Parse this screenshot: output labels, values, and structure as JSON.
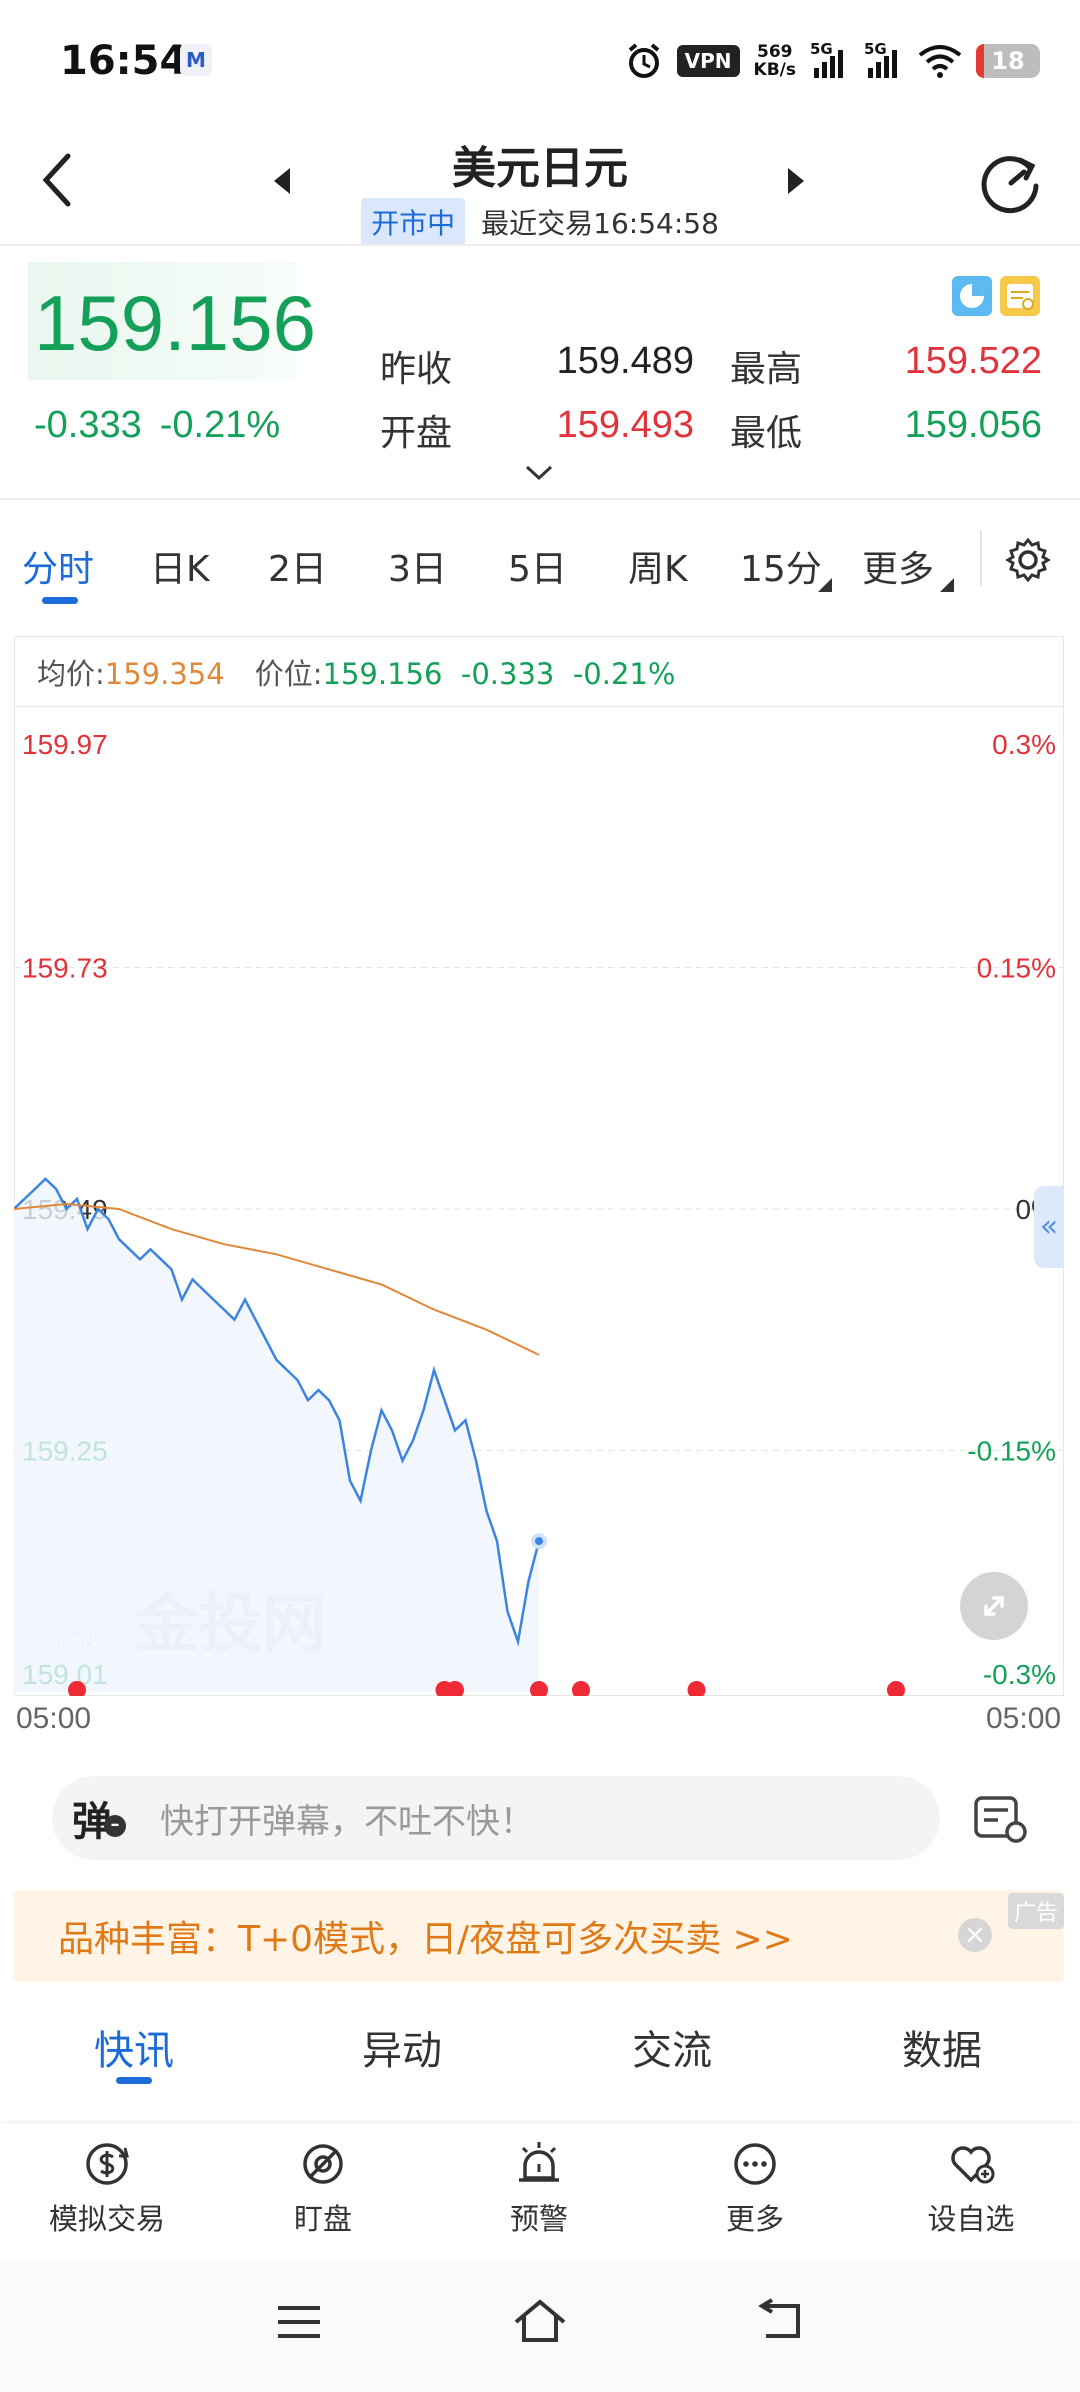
{
  "status_bar": {
    "time": "16:54",
    "vpn": "VPN",
    "speed_value": "569",
    "speed_unit": "KB/s",
    "sig1": "5G",
    "sig2": "5G",
    "battery": "18"
  },
  "header": {
    "title": "美元日元",
    "status_badge": "开市中",
    "last_trade": "最近交易16:54:58"
  },
  "quote": {
    "price": "159.156",
    "change": "-0.333",
    "change_pct": "-0.21%",
    "prev_close_label": "昨收",
    "prev_close": "159.489",
    "high_label": "最高",
    "high": "159.522",
    "open_label": "开盘",
    "open": "159.493",
    "low_label": "最低",
    "low": "159.056"
  },
  "tabs": [
    "分时",
    "日K",
    "2日",
    "3日",
    "5日",
    "周K",
    "15分",
    "更多"
  ],
  "legend": {
    "avg_label": "均价:",
    "avg_value": "159.354",
    "pos_label": "价位:",
    "pos_value": "159.156",
    "pos_change": "-0.333",
    "pos_change_pct": "-0.21%"
  },
  "chart_data": {
    "type": "line",
    "ylim": [
      159.01,
      159.97
    ],
    "y_ticks_left": [
      "159.97",
      "159.73",
      "159.49",
      "159.25",
      "159.01"
    ],
    "y_ticks_right": [
      "0.3%",
      "0.15%",
      "0%",
      "-0.15%",
      "-0.3%"
    ],
    "x_ticks": [
      "05:00",
      "05:00"
    ],
    "watermark": "金投网",
    "watermark_small": "JT.CN",
    "series": [
      {
        "color": "#3b84e0",
        "x": [
          0,
          0.01,
          0.02,
          0.03,
          0.04,
          0.05,
          0.06,
          0.07,
          0.08,
          0.09,
          0.1,
          0.11,
          0.12,
          0.13,
          0.14,
          0.15,
          0.16,
          0.17,
          0.18,
          0.19,
          0.2,
          0.21,
          0.22,
          0.23,
          0.24,
          0.25,
          0.26,
          0.27,
          0.28,
          0.29,
          0.3,
          0.31,
          0.32,
          0.33,
          0.34,
          0.35,
          0.36,
          0.37,
          0.38,
          0.39,
          0.4,
          0.41,
          0.42,
          0.43,
          0.44,
          0.45,
          0.46,
          0.47,
          0.48,
          0.49,
          0.5
        ],
        "values": [
          159.49,
          159.5,
          159.51,
          159.52,
          159.51,
          159.49,
          159.5,
          159.47,
          159.49,
          159.48,
          159.46,
          159.45,
          159.44,
          159.45,
          159.44,
          159.43,
          159.4,
          159.42,
          159.41,
          159.4,
          159.39,
          159.38,
          159.4,
          159.38,
          159.36,
          159.34,
          159.33,
          159.32,
          159.3,
          159.31,
          159.3,
          159.28,
          159.22,
          159.2,
          159.25,
          159.29,
          159.27,
          159.24,
          159.26,
          159.29,
          159.33,
          159.3,
          159.27,
          159.28,
          159.24,
          159.19,
          159.16,
          159.09,
          159.06,
          159.12,
          159.16
        ]
      },
      {
        "color": "#e0883a",
        "x": [
          0,
          0.05,
          0.1,
          0.15,
          0.2,
          0.25,
          0.3,
          0.35,
          0.4,
          0.45,
          0.5
        ],
        "values": [
          159.49,
          159.495,
          159.49,
          159.47,
          159.455,
          159.445,
          159.43,
          159.415,
          159.39,
          159.37,
          159.345
        ]
      }
    ],
    "markers": [
      0.06,
      0.41,
      0.42,
      0.5,
      0.54,
      0.65,
      0.84
    ],
    "grid": true
  },
  "danmu": {
    "icon_label": "弹",
    "placeholder": "快打开弹幕，不吐不快！"
  },
  "ad": {
    "text": "品种丰富：T+0模式，日/夜盘可多次买卖 >>",
    "tag": "广告"
  },
  "news_tabs": [
    "快讯",
    "异动",
    "交流",
    "数据"
  ],
  "bottom_actions": [
    {
      "label": "模拟交易",
      "icon": "dollar-swap-icon"
    },
    {
      "label": "盯盘",
      "icon": "eye-off-icon"
    },
    {
      "label": "预警",
      "icon": "alarm-light-icon"
    },
    {
      "label": "更多",
      "icon": "more-dots-icon"
    },
    {
      "label": "设自选",
      "icon": "heart-add-icon"
    }
  ]
}
